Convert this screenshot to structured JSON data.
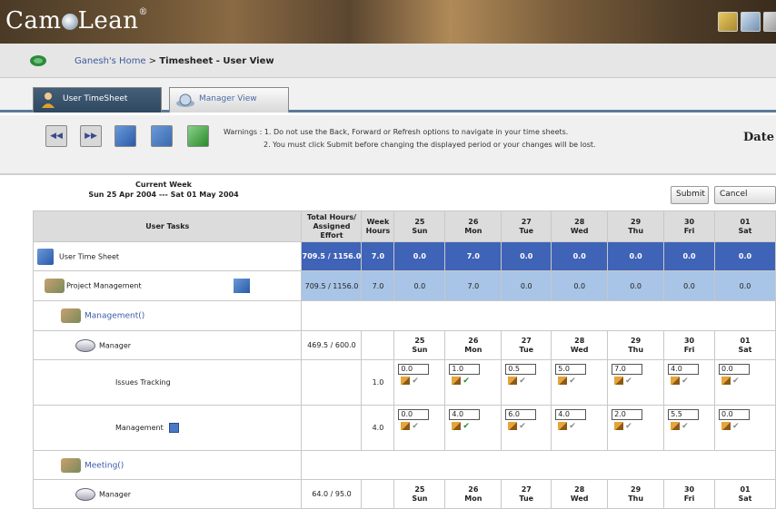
{
  "header": {
    "logo_prefix": "Cam",
    "logo_suffix": "Lean",
    "logo_mark": "®"
  },
  "breadcrumb": {
    "home": "Ganesh's Home",
    "separator": ">",
    "current": "Timesheet - User View"
  },
  "tabs": {
    "user": "User TimeSheet",
    "manager": "Manager View"
  },
  "toolbar": {
    "warning_label": "Warnings :",
    "warning1": "1. Do not use the Back, Forward or Refresh options to navigate in your time sheets.",
    "warning2": "2. You must click Submit before changing the displayed period or your changes will be lost.",
    "date_label": "Date"
  },
  "week": {
    "heading": "Current Week",
    "range": "Sun 25 Apr 2004 --- Sat 01 May 2004",
    "submit": "Submit",
    "cancel": "Cancel"
  },
  "grid": {
    "headers": {
      "tasks": "User Tasks",
      "total": "Total Hours/ Assigned Effort",
      "week": "Week Hours"
    },
    "days": [
      {
        "num": "25",
        "day": "Sun"
      },
      {
        "num": "26",
        "day": "Mon"
      },
      {
        "num": "27",
        "day": "Tue"
      },
      {
        "num": "28",
        "day": "Wed"
      },
      {
        "num": "29",
        "day": "Thu"
      },
      {
        "num": "30",
        "day": "Fri"
      },
      {
        "num": "01",
        "day": "Sat"
      }
    ],
    "user_row": {
      "label": "User Time Sheet",
      "total": "709.5 / 1156.0",
      "week": "7.0",
      "values": [
        "0.0",
        "7.0",
        "0.0",
        "0.0",
        "0.0",
        "0.0",
        "0.0"
      ]
    },
    "project_row": {
      "label": "Project Management",
      "total": "709.5 / 1156.0",
      "week": "7.0",
      "values": [
        "0.0",
        "7.0",
        "0.0",
        "0.0",
        "0.0",
        "0.0",
        "0.0"
      ]
    },
    "category1": {
      "label": "Management()"
    },
    "manager1": {
      "label": "Manager",
      "total": "469.5 / 600.0"
    },
    "issues": {
      "label": "Issues Tracking",
      "week": "1.0",
      "values": [
        "0.0",
        "1.0",
        "0.5",
        "5.0",
        "7.0",
        "4.0",
        "0.0"
      ]
    },
    "management": {
      "label": "Management",
      "week": "4.0",
      "values": [
        "0.0",
        "4.0",
        "6.0",
        "4.0",
        "2.0",
        "5.5",
        "0.0"
      ]
    },
    "category2": {
      "label": "Meeting()"
    },
    "manager2": {
      "label": "Manager",
      "total": "64.0 / 95.0"
    }
  }
}
